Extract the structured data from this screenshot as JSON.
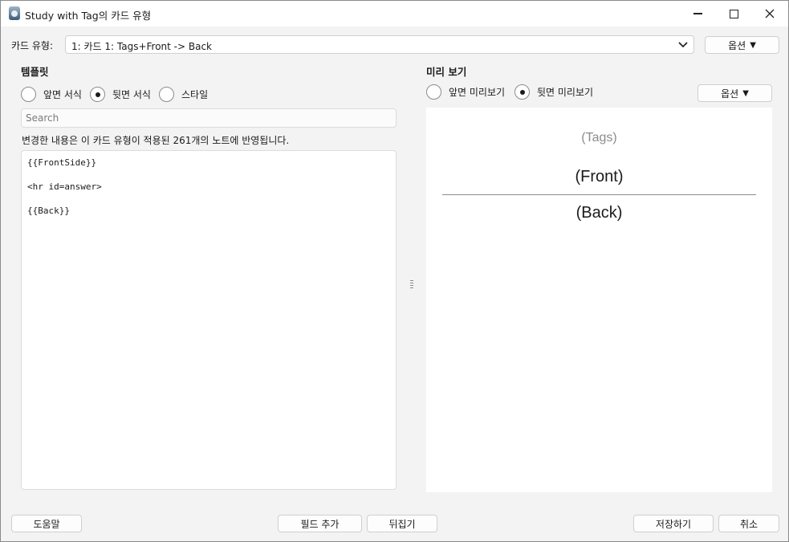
{
  "window": {
    "title": "Study with Tag의 카드 유형"
  },
  "card_type": {
    "label": "카드 유형:",
    "selected": "1: 카드 1: Tags+Front -> Back",
    "options_button": "옵션",
    "options_arrow": "▼"
  },
  "template": {
    "section_title": "템플릿",
    "radios": [
      {
        "label": "앞면 서식",
        "checked": false
      },
      {
        "label": "뒷면 서식",
        "checked": true
      },
      {
        "label": "스타일",
        "checked": false
      }
    ],
    "search_placeholder": "Search",
    "notice": "변경한 내용은 이 카드 유형이 적용된 261개의 노트에 반영됩니다.",
    "code_lines": [
      "{{FrontSide}}",
      "<hr id=answer>",
      "{{Back}}"
    ]
  },
  "preview": {
    "section_title": "미리 보기",
    "radios": [
      {
        "label": "앞면 미리보기",
        "checked": false
      },
      {
        "label": "뒷면 미리보기",
        "checked": true
      }
    ],
    "options_button": "옵션",
    "options_arrow": "▼",
    "tags_text": "(Tags)",
    "front_text": "(Front)",
    "back_text": "(Back)"
  },
  "footer": {
    "help": "도움말",
    "add_field": "필드 추가",
    "flip": "뒤집기",
    "save": "저장하기",
    "cancel": "취소"
  },
  "icons": {
    "app": "app-icon",
    "minimize": "minimize-icon",
    "maximize": "maximize-icon",
    "close": "close-icon",
    "dropdown": "chevron-down-icon",
    "splitter": "splitter-handle-icon"
  }
}
